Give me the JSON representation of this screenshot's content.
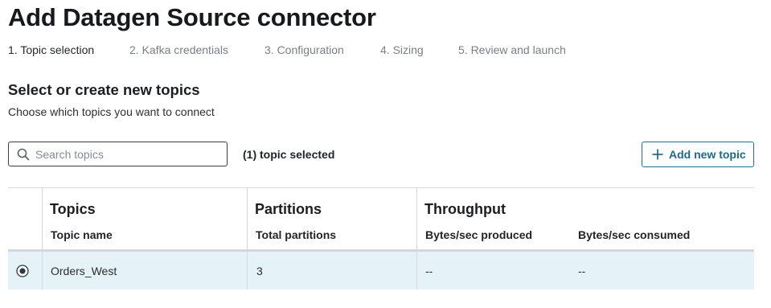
{
  "page": {
    "title": "Add Datagen Source connector"
  },
  "steps": [
    {
      "label": "1. Topic selection",
      "active": true
    },
    {
      "label": "2. Kafka credentials",
      "active": false
    },
    {
      "label": "3. Configuration",
      "active": false
    },
    {
      "label": "4. Sizing",
      "active": false
    },
    {
      "label": "5. Review and launch",
      "active": false
    }
  ],
  "section": {
    "title": "Select or create new topics",
    "subtitle": "Choose which topics you want to connect"
  },
  "search": {
    "placeholder": "Search topics",
    "value": "",
    "icon": "search-icon"
  },
  "selection_status": "(1) topic selected",
  "add_topic_button": {
    "label": "Add new topic",
    "icon": "plus-icon"
  },
  "table": {
    "groups": {
      "topics": "Topics",
      "partitions": "Partitions",
      "throughput": "Throughput"
    },
    "columns": {
      "topic_name": "Topic name",
      "total_partitions": "Total partitions",
      "bytes_produced": "Bytes/sec produced",
      "bytes_consumed": "Bytes/sec consumed"
    },
    "rows": [
      {
        "selected": true,
        "topic_name": "Orders_West",
        "total_partitions": "3",
        "bytes_produced": "--",
        "bytes_consumed": "--"
      }
    ]
  },
  "colors": {
    "accent": "#1c6a8a",
    "selected_row": "#e5f2f8",
    "border": "#d5d8dc",
    "muted_text": "#7a7f85"
  }
}
